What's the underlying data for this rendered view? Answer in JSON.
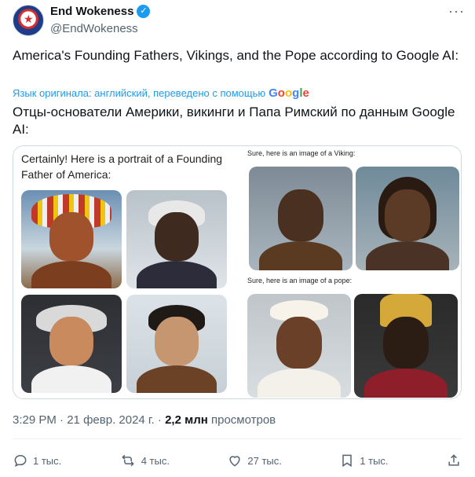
{
  "author": {
    "display_name": "End Wokeness",
    "handle": "@EndWokeness",
    "verified_icon": "verified-badge-icon",
    "avatar_icon": "avatar-icon"
  },
  "tweet": {
    "text": "America's Founding Fathers, Vikings, and the Pope according to Google AI:",
    "translate_label": "Язык оригинала: английский, переведено с помощью",
    "translate_logo": "Google",
    "translated_text": "Отцы-основатели Америки, викинги и Папа Римский по данным Google AI:"
  },
  "media": {
    "left_caption": "Certainly! Here is a portrait of a Founding Father of America:",
    "viking_caption": "Sure, here is an image of a Viking:",
    "pope_caption": "Sure, here is an image of a pope:"
  },
  "meta": {
    "time": "3:29 PM",
    "date": "21 февр. 2024 г.",
    "views_count": "2,2 млн",
    "views_label": "просмотров",
    "separator": "·"
  },
  "actions": {
    "reply": "1 тыс.",
    "retweet": "4 тыс.",
    "like": "27 тыс.",
    "bookmark": "1 тыс."
  },
  "colors": {
    "accent": "#1d9bf0",
    "text": "#0f1419",
    "muted": "#536471"
  }
}
